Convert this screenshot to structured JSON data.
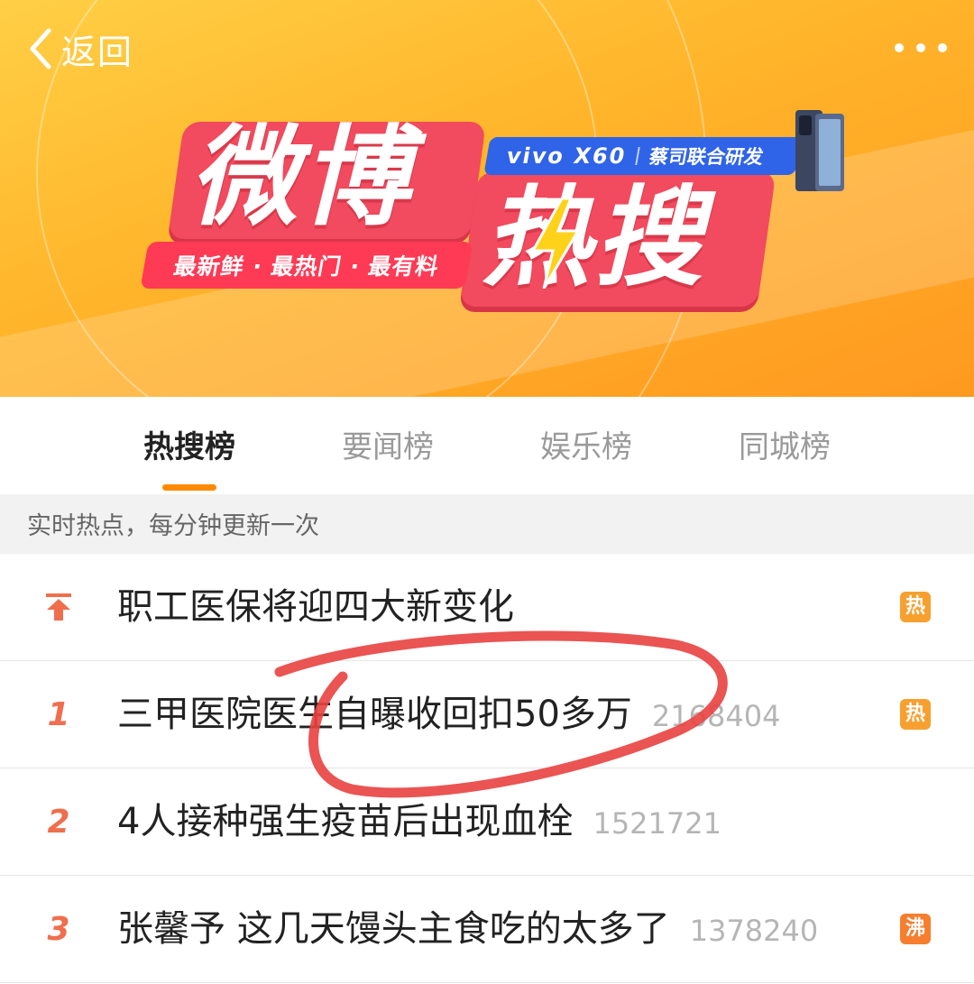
{
  "nav": {
    "back_label": "返回"
  },
  "banner": {
    "title_part1": "微博",
    "title_part2": "热搜",
    "slogan": "最新鲜 · 最热门 · 最有料",
    "promo_brand": "vivo X60",
    "promo_sub": "蔡司联合研发",
    "colors": {
      "bg": "#ffb42a",
      "card": "#f24a5e",
      "promo": "#2f63e8"
    }
  },
  "tabs": [
    {
      "label": "热搜榜",
      "active": true
    },
    {
      "label": "要闻榜",
      "active": false
    },
    {
      "label": "娱乐榜",
      "active": false
    },
    {
      "label": "同城榜",
      "active": false
    }
  ],
  "notice": "实时热点，每分钟更新一次",
  "list": [
    {
      "rank": "",
      "pinned": true,
      "title": "职工医保将迎四大新变化",
      "count": "",
      "badge": "热",
      "badge_color": "#f7a030"
    },
    {
      "rank": "1",
      "pinned": false,
      "title": "三甲医院医生自曝收回扣50多万",
      "count": "2168404",
      "badge": "热",
      "badge_color": "#f7a030"
    },
    {
      "rank": "2",
      "pinned": false,
      "title": "4人接种强生疫苗后出现血栓",
      "count": "1521721",
      "badge": "",
      "badge_color": ""
    },
    {
      "rank": "3",
      "pinned": false,
      "title": "张馨予 这几天馒头主食吃的太多了",
      "count": "1378240",
      "badge": "沸",
      "badge_color": "#f77e2e"
    }
  ]
}
